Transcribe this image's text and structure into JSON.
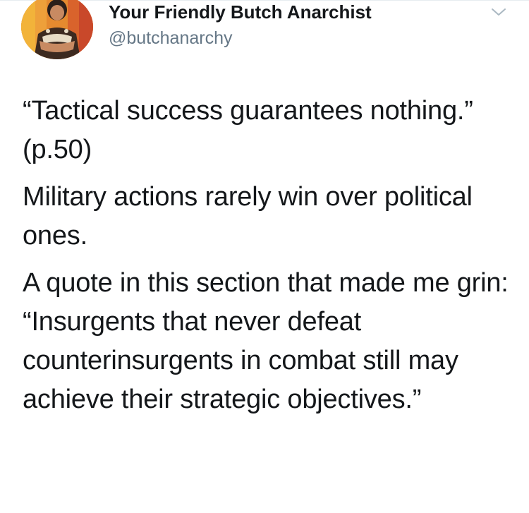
{
  "header": {
    "display_name": "Your Friendly Butch Anarchist",
    "handle": "@butchanarchy",
    "avatar_icon": "avatar-illustration",
    "menu_icon": "chevron-down-icon"
  },
  "tweet": {
    "paragraphs": [
      "“Tactical success guarantees nothing.” (p.50)",
      "Military actions rarely win over political ones.",
      "A quote in this section that made me grin: “Insurgents that never defeat counterinsurgents in combat still may achieve their strategic objectives.”"
    ]
  },
  "colors": {
    "text": "#14171a",
    "secondary": "#657786",
    "avatar_bg": "#d8772d",
    "divider": "#e6ecf0"
  }
}
